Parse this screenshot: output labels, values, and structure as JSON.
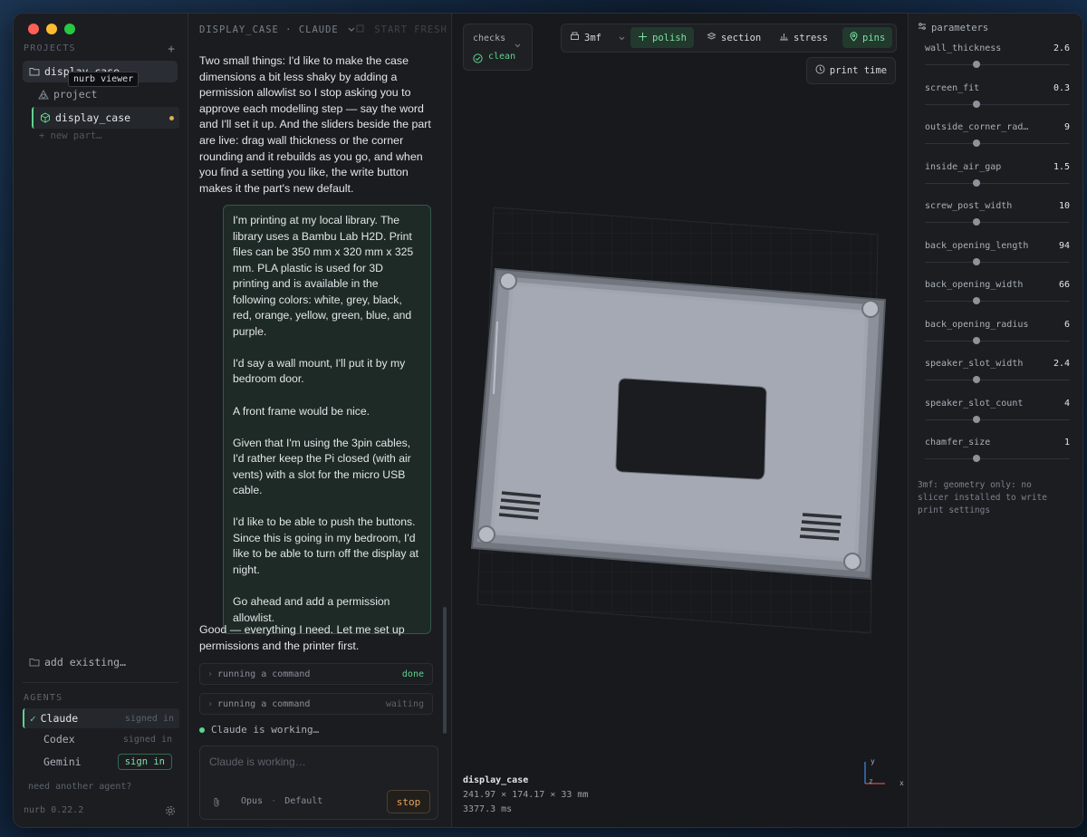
{
  "sidebar": {
    "projects_label": "PROJECTS",
    "add_project": "+",
    "project_name": "display_case",
    "tooltip": "nurb viewer",
    "project_item": "project",
    "part_name": "display_case",
    "new_part": "+ new part…",
    "add_existing": "add existing…",
    "agents_label": "AGENTS",
    "agents": [
      {
        "name": "Claude",
        "status": "signed in",
        "check": "✓"
      },
      {
        "name": "Codex",
        "status": "signed in"
      },
      {
        "name": "Gemini",
        "action": "sign in"
      }
    ],
    "need_agent": "need another agent?",
    "version": "nurb 0.22.2"
  },
  "chat": {
    "header": "DISPLAY_CASE · CLAUDE",
    "start_fresh": "START FRESH",
    "assistant_intro": "Two small things: I'd like to make the case dimensions a bit less shaky by adding a permission allowlist so I stop asking you to approve each modelling step — say the word and I'll set it up. And the sliders beside the part are live: drag wall thickness or the corner rounding and it rebuilds as you go, and when you find a setting you like, the write button makes it the part's new default.",
    "user_paragraphs": [
      "I'm printing at my local library. The library uses a Bambu Lab H2D. Print files can be 350 mm x 320 mm x 325 mm. PLA plastic is used for 3D printing and is available in the following colors: white, grey, black, red, orange, yellow, green, blue, and purple.",
      "I'd say a wall mount, I'll put it by my bedroom door.",
      "A front frame would be nice.",
      "Given that I'm using the 3pin cables, I'd rather keep the Pi closed (with air vents) with a slot for the micro USB cable.",
      "I'd like to be able to push the buttons. Since this is going in my bedroom, I'd like to be able to turn off the display at night.",
      "Go ahead and add a permission allowlist."
    ],
    "assistant_reply": "Good — everything I need. Let me set up permissions and the printer first.",
    "commands": [
      {
        "label": "running a command",
        "status": "done"
      },
      {
        "label": "running a command",
        "status": "waiting"
      }
    ],
    "working": "Claude is working…",
    "input_placeholder": "Claude is working…",
    "model": "Opus",
    "mode": "Default",
    "stop": "stop"
  },
  "viewport": {
    "checks_label": "checks",
    "checks_status": "clean",
    "toolbar": {
      "format": "3mf",
      "polish": "polish",
      "section": "section",
      "stress": "stress",
      "pins": "pins"
    },
    "print_time": "print time",
    "part_name": "display_case",
    "dimensions": "241.97 × 174.17 × 33 mm",
    "render_time": "3377.3 ms",
    "axes": {
      "y": "y",
      "z": "z",
      "x": "x"
    }
  },
  "parameters": {
    "title": "parameters",
    "items": [
      {
        "name": "wall_thickness",
        "value": "2.6"
      },
      {
        "name": "screen_fit",
        "value": "0.3"
      },
      {
        "name": "outside_corner_rad…",
        "value": "9"
      },
      {
        "name": "inside_air_gap",
        "value": "1.5"
      },
      {
        "name": "screw_post_width",
        "value": "10"
      },
      {
        "name": "back_opening_length",
        "value": "94"
      },
      {
        "name": "back_opening_width",
        "value": "66"
      },
      {
        "name": "back_opening_radius",
        "value": "6"
      },
      {
        "name": "speaker_slot_width",
        "value": "2.4"
      },
      {
        "name": "speaker_slot_count",
        "value": "4"
      },
      {
        "name": "chamfer_size",
        "value": "1"
      }
    ],
    "note": "3mf: geometry only: no slicer installed to write print settings"
  },
  "colors": {
    "accent_green": "#5fd38d",
    "dirty_dot": "#d9b24c",
    "stop_orange": "#e6a35a"
  }
}
